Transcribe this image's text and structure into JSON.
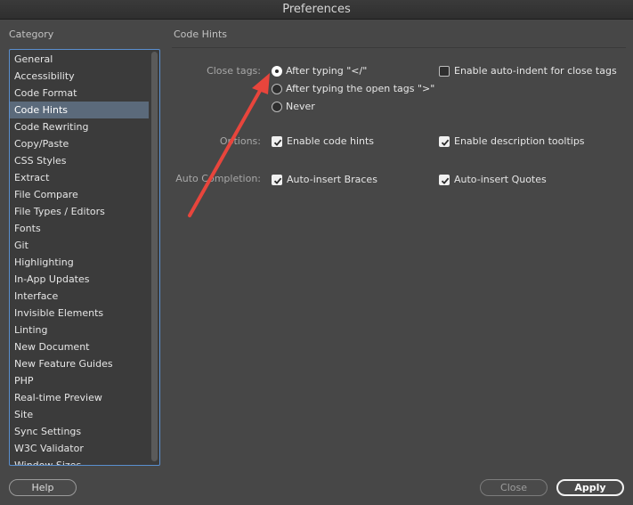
{
  "window": {
    "title": "Preferences"
  },
  "sidebar": {
    "heading": "Category",
    "items": [
      "General",
      "Accessibility",
      "Code Format",
      "Code Hints",
      "Code Rewriting",
      "Copy/Paste",
      "CSS Styles",
      "Extract",
      "File Compare",
      "File Types / Editors",
      "Fonts",
      "Git",
      "Highlighting",
      "In-App Updates",
      "Interface",
      "Invisible Elements",
      "Linting",
      "New Document",
      "New Feature Guides",
      "PHP",
      "Real-time Preview",
      "Site",
      "Sync Settings",
      "W3C Validator",
      "Window Sizes"
    ],
    "selected": "Code Hints"
  },
  "panel": {
    "heading": "Code Hints",
    "close_tags": {
      "label": "Close tags:",
      "options": [
        "After typing \"</\"",
        "After typing the open tags \">\"",
        "Never"
      ],
      "selected_index": 0,
      "auto_indent": {
        "label": "Enable auto-indent for close tags",
        "checked": false
      }
    },
    "options": {
      "label": "Options:",
      "code_hints": {
        "label": "Enable code hints",
        "checked": true
      },
      "description_tooltips": {
        "label": "Enable description tooltips",
        "checked": true
      }
    },
    "auto_completion": {
      "label": "Auto Completion:",
      "braces": {
        "label": "Auto-insert Braces",
        "checked": true
      },
      "quotes": {
        "label": "Auto-insert Quotes",
        "checked": true
      }
    }
  },
  "footer": {
    "help_label": "Help",
    "close_label": "Close",
    "apply_label": "Apply"
  },
  "annotation": {
    "color": "#e8453c"
  }
}
